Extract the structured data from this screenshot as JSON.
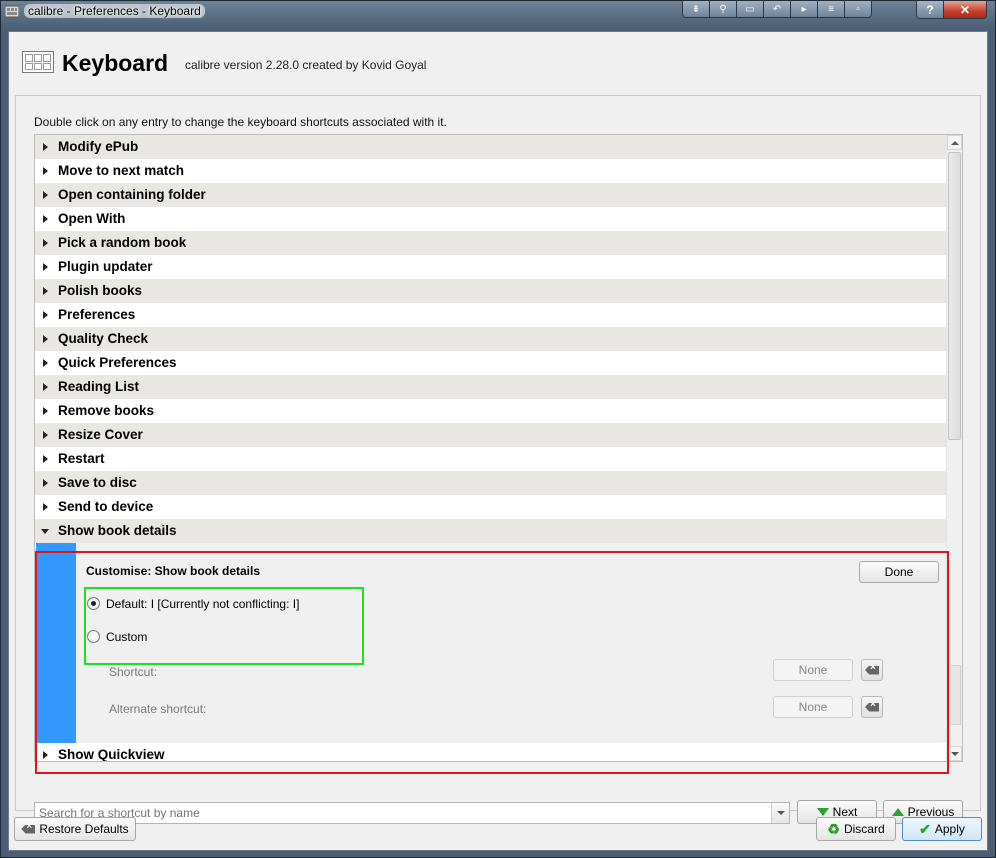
{
  "window": {
    "title": "calibre - Preferences - Keyboard",
    "close_glyph": "✕",
    "help_glyph": "?"
  },
  "header": {
    "title": "Keyboard",
    "version": "calibre version 2.28.0 created by Kovid Goyal"
  },
  "hint": "Double click on any entry to change the keyboard shortcuts associated with it.",
  "tree": {
    "items": [
      "Modify ePub",
      "Move to next match",
      "Open containing folder",
      "Open With",
      "Pick a random book",
      "Plugin updater",
      "Polish books",
      "Preferences",
      "Quality Check",
      "Quick Preferences",
      "Reading List",
      "Remove books",
      "Resize Cover",
      "Restart",
      "Save to disc",
      "Send to device",
      "Show book details",
      "Show Quickview"
    ],
    "expanded_item": "Show book details"
  },
  "editor": {
    "title": "Customise: Show book details",
    "done": "Done",
    "default_option": "Default: I [Currently not conflicting: I]",
    "custom_option": "Custom",
    "shortcut_label": "Shortcut:",
    "shortcut_value": "None",
    "alternate_label": "Alternate shortcut:",
    "alternate_value": "None"
  },
  "search": {
    "placeholder": "Search for a shortcut by name"
  },
  "nav": {
    "next": "Next",
    "previous": "Previous"
  },
  "footer": {
    "restore": "Restore Defaults",
    "discard": "Discard",
    "apply": "Apply"
  }
}
